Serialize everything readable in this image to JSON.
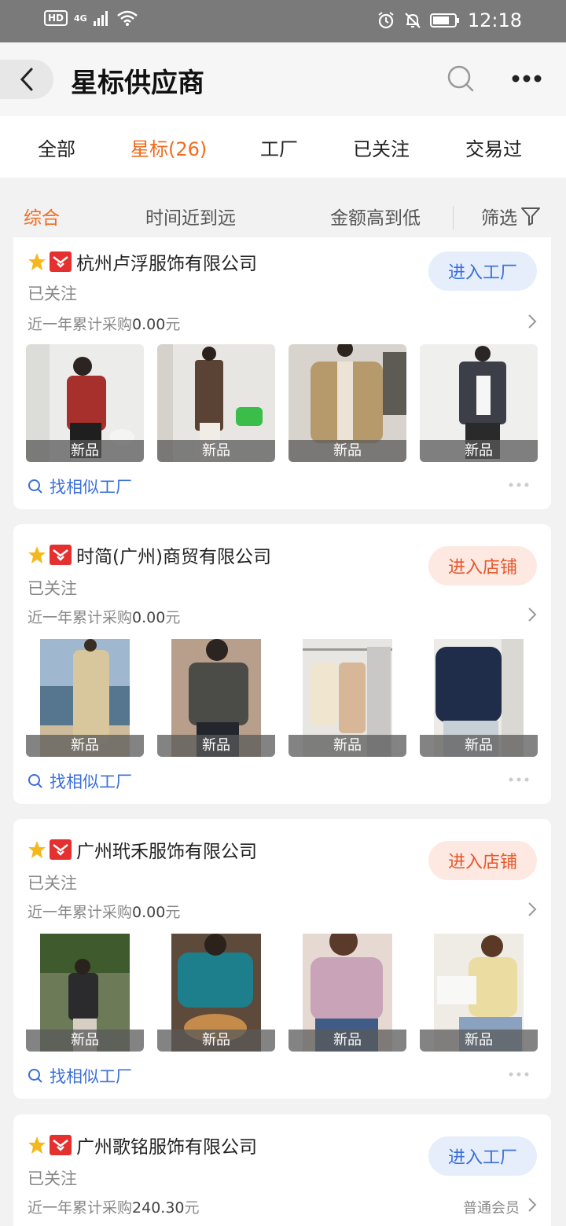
{
  "status_bar": {
    "hd": "HD",
    "network": "4G",
    "time": "12:18"
  },
  "header": {
    "title": "星标供应商"
  },
  "tabs": [
    {
      "label": "全部"
    },
    {
      "label": "星标(26)"
    },
    {
      "label": "工厂"
    },
    {
      "label": "已关注"
    },
    {
      "label": "交易过"
    }
  ],
  "sort": {
    "comprehensive": "综合",
    "time": "时间近到远",
    "amount": "金额高到低",
    "filter": "筛选"
  },
  "cards": [
    {
      "name": "杭州卢浮服饰有限公司",
      "followed": "已关注",
      "purchase_label": "近一年累计采购",
      "purchase_amount": "0.00",
      "currency": "元",
      "button": "进入工厂",
      "similar": "找相似工厂",
      "thumbs": [
        "新品",
        "新品",
        "新品",
        "新品"
      ]
    },
    {
      "name": "时简(广州)商贸有限公司",
      "followed": "已关注",
      "purchase_label": "近一年累计采购",
      "purchase_amount": "0.00",
      "currency": "元",
      "button": "进入店铺",
      "similar": "找相似工厂",
      "thumbs": [
        "新品",
        "新品",
        "新品",
        "新品"
      ]
    },
    {
      "name": "广州玳禾服饰有限公司",
      "followed": "已关注",
      "purchase_label": "近一年累计采购",
      "purchase_amount": "0.00",
      "currency": "元",
      "button": "进入店铺",
      "similar": "找相似工厂",
      "thumbs": [
        "新品",
        "新品",
        "新品",
        "新品"
      ]
    },
    {
      "name": "广州歌铭服饰有限公司",
      "followed": "已关注",
      "purchase_label": "近一年累计采购",
      "purchase_amount": "240.30",
      "currency": "元",
      "member_level": "普通会员",
      "button": "进入工厂"
    }
  ],
  "colors": {
    "accent": "#f26b1d",
    "link_blue": "#3b6fd8",
    "factory_btn_bg": "#e6eefc",
    "shop_btn_bg": "#fde9e2",
    "shop_btn_text": "#e8572b"
  }
}
